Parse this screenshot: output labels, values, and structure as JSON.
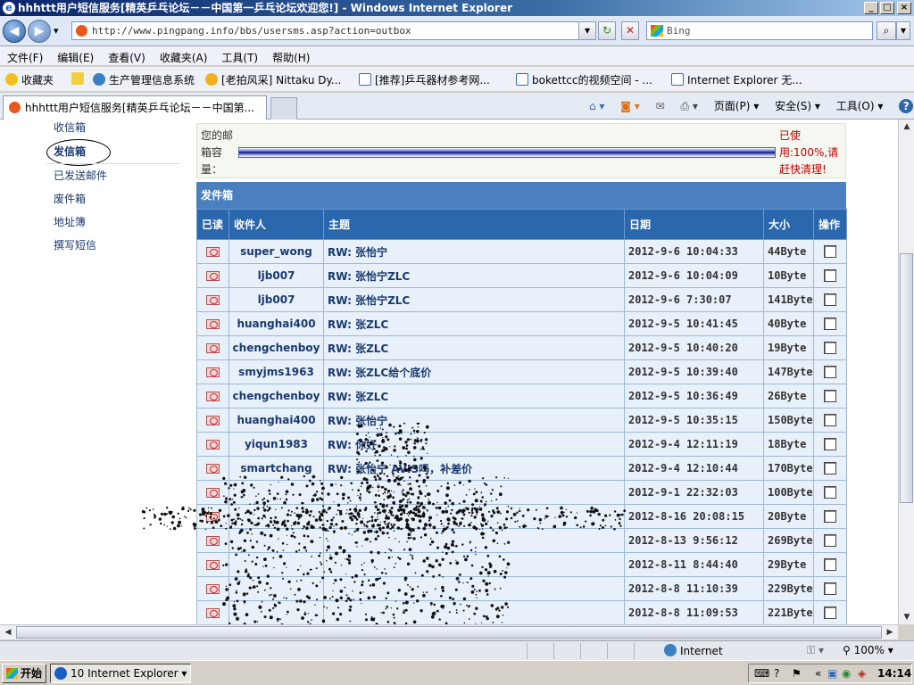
{
  "window": {
    "title": "hhhttt用户短信服务[精英乒乓论坛－－中国第一乒乓论坛欢迎您!] - Windows Internet Explorer",
    "min": "_",
    "max": "□",
    "close": "×"
  },
  "nav": {
    "back": "◀",
    "forward": "▶",
    "dropdown": "▾",
    "address": "http://www.pingpang.info/bbs/usersms.asp?action=outbox",
    "refresh": "↻",
    "stop": "✕",
    "search_placeholder": "Bing",
    "search_btn": "⌕"
  },
  "menu": [
    "文件(F)",
    "编辑(E)",
    "查看(V)",
    "收藏夹(A)",
    "工具(T)",
    "帮助(H)"
  ],
  "favorites": {
    "label": "收藏夹",
    "items": [
      "生产管理信息系统",
      "[老拍风采] Nittaku Dy...",
      "[推荐]乒乓器材参考网...",
      "bokettcc的视频空间 - ...",
      "Internet Explorer 无..."
    ]
  },
  "tab": {
    "title": "hhhttt用户短信服务[精英乒乓论坛－－中国第..."
  },
  "commands": [
    "页面(P) ▾",
    "安全(S) ▾",
    "工具(O) ▾",
    "?"
  ],
  "sidebar": {
    "items": [
      "收信箱",
      "发信箱",
      "已发送邮件",
      "废件箱",
      "地址簿",
      "撰写短信"
    ],
    "active_index": 1
  },
  "capacity": {
    "label": "您的邮箱容量：",
    "message": "已使用:100%,请赶快清理!",
    "used_percent": 100
  },
  "outbox": {
    "title": "发件箱",
    "columns": [
      "已读",
      "收件人",
      "主题",
      "日期",
      "大小",
      "操作"
    ],
    "rows": [
      {
        "to": "super_wong",
        "subject": "RW: 张怡宁",
        "date": "2012-9-6 10:04:33",
        "size": "44Byte"
      },
      {
        "to": "ljb007",
        "subject": "RW: 张怡宁ZLC",
        "date": "2012-9-6 10:04:09",
        "size": "10Byte"
      },
      {
        "to": "ljb007",
        "subject": "RW: 张怡宁ZLC",
        "date": "2012-9-6 7:30:07",
        "size": "141Byte"
      },
      {
        "to": "huanghai400",
        "subject": "RW: 张ZLC",
        "date": "2012-9-5 10:41:45",
        "size": "40Byte"
      },
      {
        "to": "chengchenboy",
        "subject": "RW: 张ZLC",
        "date": "2012-9-5 10:40:20",
        "size": "19Byte"
      },
      {
        "to": "smyjms1963",
        "subject": "RW: 张ZLC给个底价",
        "date": "2012-9-5 10:39:40",
        "size": "147Byte"
      },
      {
        "to": "chengchenboy",
        "subject": "RW: 张ZLC",
        "date": "2012-9-5 10:36:49",
        "size": "26Byte"
      },
      {
        "to": "huanghai400",
        "subject": "RW: 张怡宁",
        "date": "2012-9-5 10:35:15",
        "size": "150Byte"
      },
      {
        "to": "yiqun1983",
        "subject": "RW: 你好",
        "date": "2012-9-4 12:11:19",
        "size": "18Byte"
      },
      {
        "to": "smartchang",
        "subject": "RW: 张怡宁 AVIS吗，补差价",
        "date": "2012-9-4 12:10:44",
        "size": "170Byte"
      },
      {
        "to": "",
        "subject": "",
        "date": "2012-9-1 22:32:03",
        "size": "100Byte"
      },
      {
        "to": "",
        "subject": "",
        "date": "2012-8-16 20:08:15",
        "size": "20Byte"
      },
      {
        "to": "",
        "subject": "",
        "date": "2012-8-13 9:56:12",
        "size": "269Byte"
      },
      {
        "to": "",
        "subject": "",
        "date": "2012-8-11 8:44:40",
        "size": "29Byte"
      },
      {
        "to": "",
        "subject": "",
        "date": "2012-8-8 11:10:39",
        "size": "229Byte"
      },
      {
        "to": "",
        "subject": "",
        "date": "2012-8-8 11:09:53",
        "size": "221Byte"
      }
    ]
  },
  "status": {
    "zone": "Internet",
    "zoom": "100%"
  },
  "taskbar": {
    "start": "开始",
    "task": "10 Internet Explorer",
    "time": "14:14"
  },
  "colors": {
    "header_blue": "#2a67ad",
    "warning_red": "#c00000"
  }
}
